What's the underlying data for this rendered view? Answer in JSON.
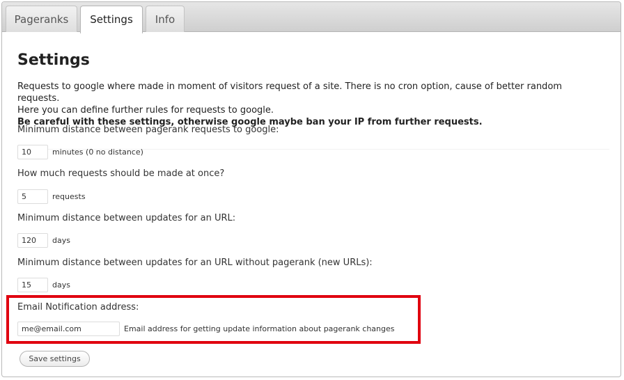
{
  "tabs": [
    {
      "label": "Pageranks",
      "active": false
    },
    {
      "label": "Settings",
      "active": true
    },
    {
      "label": "Info",
      "active": false
    }
  ],
  "page": {
    "title": "Settings",
    "intro_line1": "Requests to google where made in moment of visitors request of a site. There is no cron option, cause of better random requests.",
    "intro_line2": "Here you can define further rules for requests to google.",
    "warning": "Be careful with these settings, otherwise google maybe ban your IP from further requests."
  },
  "fields": {
    "min_distance": {
      "label": "Minimum distance between pagerank requests to google:",
      "value": "10",
      "suffix": "minutes (0 no distance)"
    },
    "requests_at_once": {
      "label": "How much requests should be made at once?",
      "value": "5",
      "suffix": "requests"
    },
    "url_update_distance": {
      "label": "Minimum distance between updates for an URL:",
      "value": "120",
      "suffix": "days"
    },
    "new_url_update_distance": {
      "label": "Minimum distance between updates for an URL without pagerank (new URLs):",
      "value": "15",
      "suffix": "days"
    },
    "email": {
      "label": "Email Notification address:",
      "value": "me@email.com",
      "hint": "Email address for getting update information about pagerank changes"
    }
  },
  "save_button": {
    "label": "Save settings"
  },
  "colors": {
    "highlight_border": "#e0000f"
  }
}
